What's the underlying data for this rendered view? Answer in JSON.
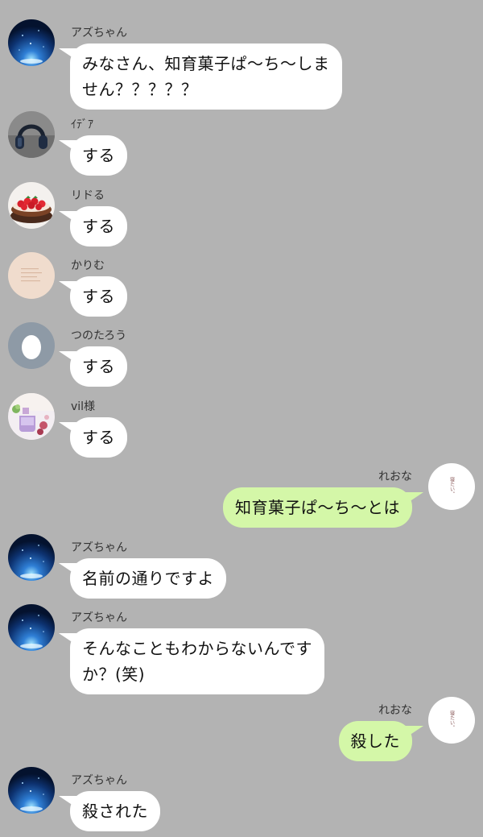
{
  "colors": {
    "background": "#b3b3b3",
    "bubble_in": "#ffffff",
    "bubble_out": "#d4f7a8"
  },
  "messages": [
    {
      "sender": "アズちゃん",
      "text": "みなさん、知育菓子ぱ〜ち〜しま\nせん？？？？？",
      "side": "left",
      "avatar_icon": "blue-sparkle-avatar-icon"
    },
    {
      "sender": "ｲﾃﾞｱ",
      "text": "する",
      "side": "left",
      "avatar_icon": "headphones-avatar-icon"
    },
    {
      "sender": "リドる",
      "text": "する",
      "side": "left",
      "avatar_icon": "strawberry-tart-avatar-icon"
    },
    {
      "sender": "かりむ",
      "text": "する",
      "side": "left",
      "avatar_icon": "pale-text-avatar-icon"
    },
    {
      "sender": "つのたろう",
      "text": "する",
      "side": "left",
      "avatar_icon": "egg-avatar-icon"
    },
    {
      "sender": "vil様",
      "text": "する",
      "side": "left",
      "avatar_icon": "perfume-avatar-icon"
    },
    {
      "sender": "れおな",
      "text": "知育菓子ぱ〜ち〜とは",
      "side": "right",
      "avatar_icon": "sleepy-text-avatar-icon",
      "avatar_text": "寝たい。"
    },
    {
      "sender": "アズちゃん",
      "text": "名前の通りですよ",
      "side": "left",
      "avatar_icon": "blue-sparkle-avatar-icon"
    },
    {
      "sender": "アズちゃん",
      "text": "そんなこともわからないんです\nか？(笑)",
      "side": "left",
      "avatar_icon": "blue-sparkle-avatar-icon"
    },
    {
      "sender": "れおな",
      "text": "殺した",
      "side": "right",
      "avatar_icon": "sleepy-text-avatar-icon",
      "avatar_text": "寝たい。"
    },
    {
      "sender": "アズちゃん",
      "text": "殺された",
      "side": "left",
      "avatar_icon": "blue-sparkle-avatar-icon"
    }
  ]
}
